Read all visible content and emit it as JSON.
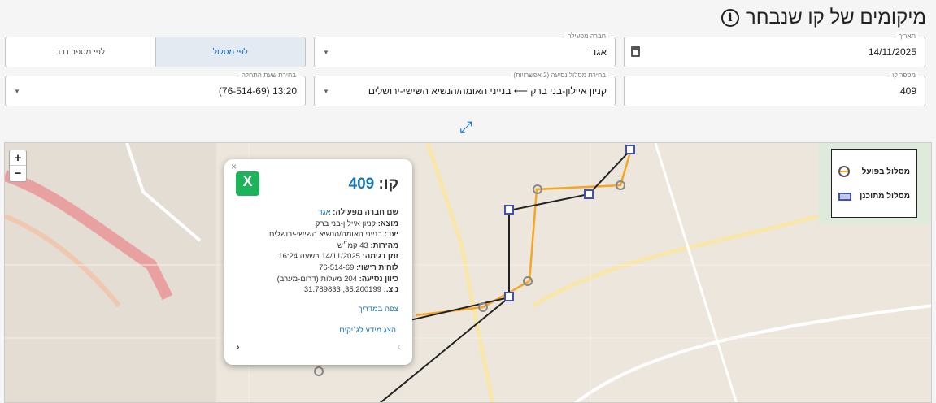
{
  "title": "מיקומים של קו שנבחר",
  "filters": {
    "date_label": "תאריך",
    "date_value": "14/11/2025",
    "operator_label": "חברה מפעילה",
    "operator_value": "אגד",
    "mode_route": "לפי מסלול",
    "mode_vehicle": "לפי מספר רכב",
    "line_label": "מספר קו",
    "line_value": "409",
    "route_label": "בחירת מסלול נסיעה (2 אפשרויות)",
    "route_value": "קניון איילון-בני ברק ⟵ בנייני האומה/הנשיא השישי-ירושלים",
    "start_label": "בחירת שעת התחלה",
    "start_value": "13:20 (76-514-69)"
  },
  "legend": {
    "actual": "מסלול בפועל",
    "planned": "מסלול מתוכנן"
  },
  "popup": {
    "line_prefix": "קו:",
    "line": "409",
    "rows": [
      {
        "k": "שם חברה מפעילה:",
        "v": "אגד"
      },
      {
        "k": "מוצא:",
        "v": "קניון איילון-בני ברק"
      },
      {
        "k": "יעד:",
        "v": "בנייני האומה/הנשיא השישי-ירושלים"
      },
      {
        "k": "מהירות:",
        "v": "43 קמ״ש"
      },
      {
        "k": "זמן דגימה:",
        "v": "14/11/2025 בשעה 16:24"
      },
      {
        "k": "לוחית רישוי:",
        "v": "76-514-69"
      },
      {
        "k": "כיוון נסיעה:",
        "v": "204 מעלות (דרום-מערב)"
      },
      {
        "k": "נ.צ.:",
        "v": "35.200199, 31.789833"
      }
    ],
    "guide_link": "צפה במדריך",
    "gigs_link": "הצג מידע לג׳יקים"
  },
  "colors": {
    "accent": "#1976d2",
    "actual": "#f5a623",
    "planned": "#3f51b5"
  }
}
